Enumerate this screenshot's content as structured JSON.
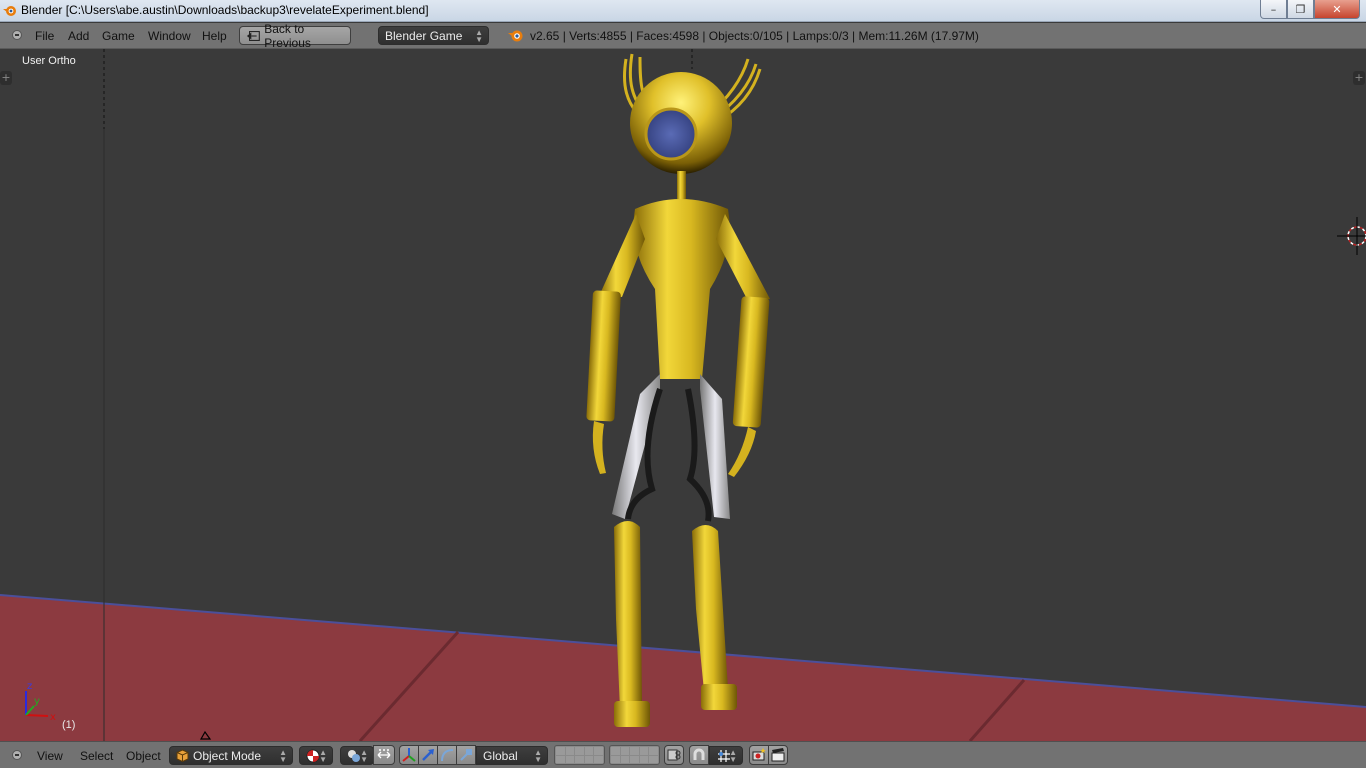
{
  "window": {
    "title": "Blender [C:\\Users\\abe.austin\\Downloads\\backup3\\revelateExperiment.blend]",
    "controls": {
      "minimize": "–",
      "maximize": "❐",
      "close": "✕"
    }
  },
  "header": {
    "menus": [
      "File",
      "Add",
      "Game",
      "Window",
      "Help"
    ],
    "back_button": "Back to Previous",
    "engine": "Blender Game",
    "stats": "v2.65 | Verts:4855 | Faces:4598 | Objects:0/105 | Lamps:0/3 | Mem:11.26M (17.97M)"
  },
  "viewport": {
    "view_label": "User Ortho",
    "frame": "(1)",
    "axes": {
      "x": "x",
      "y": "y",
      "z": "z"
    },
    "colors": {
      "background": "#3a3a3a",
      "floor": "#8c3a40",
      "gold": "#e2c22a",
      "eye": "#4a5aa0",
      "horizon": "#4b4f9a"
    }
  },
  "footer": {
    "menus": [
      "View",
      "Select",
      "Object"
    ],
    "mode": "Object Mode",
    "orientation": "Global"
  }
}
